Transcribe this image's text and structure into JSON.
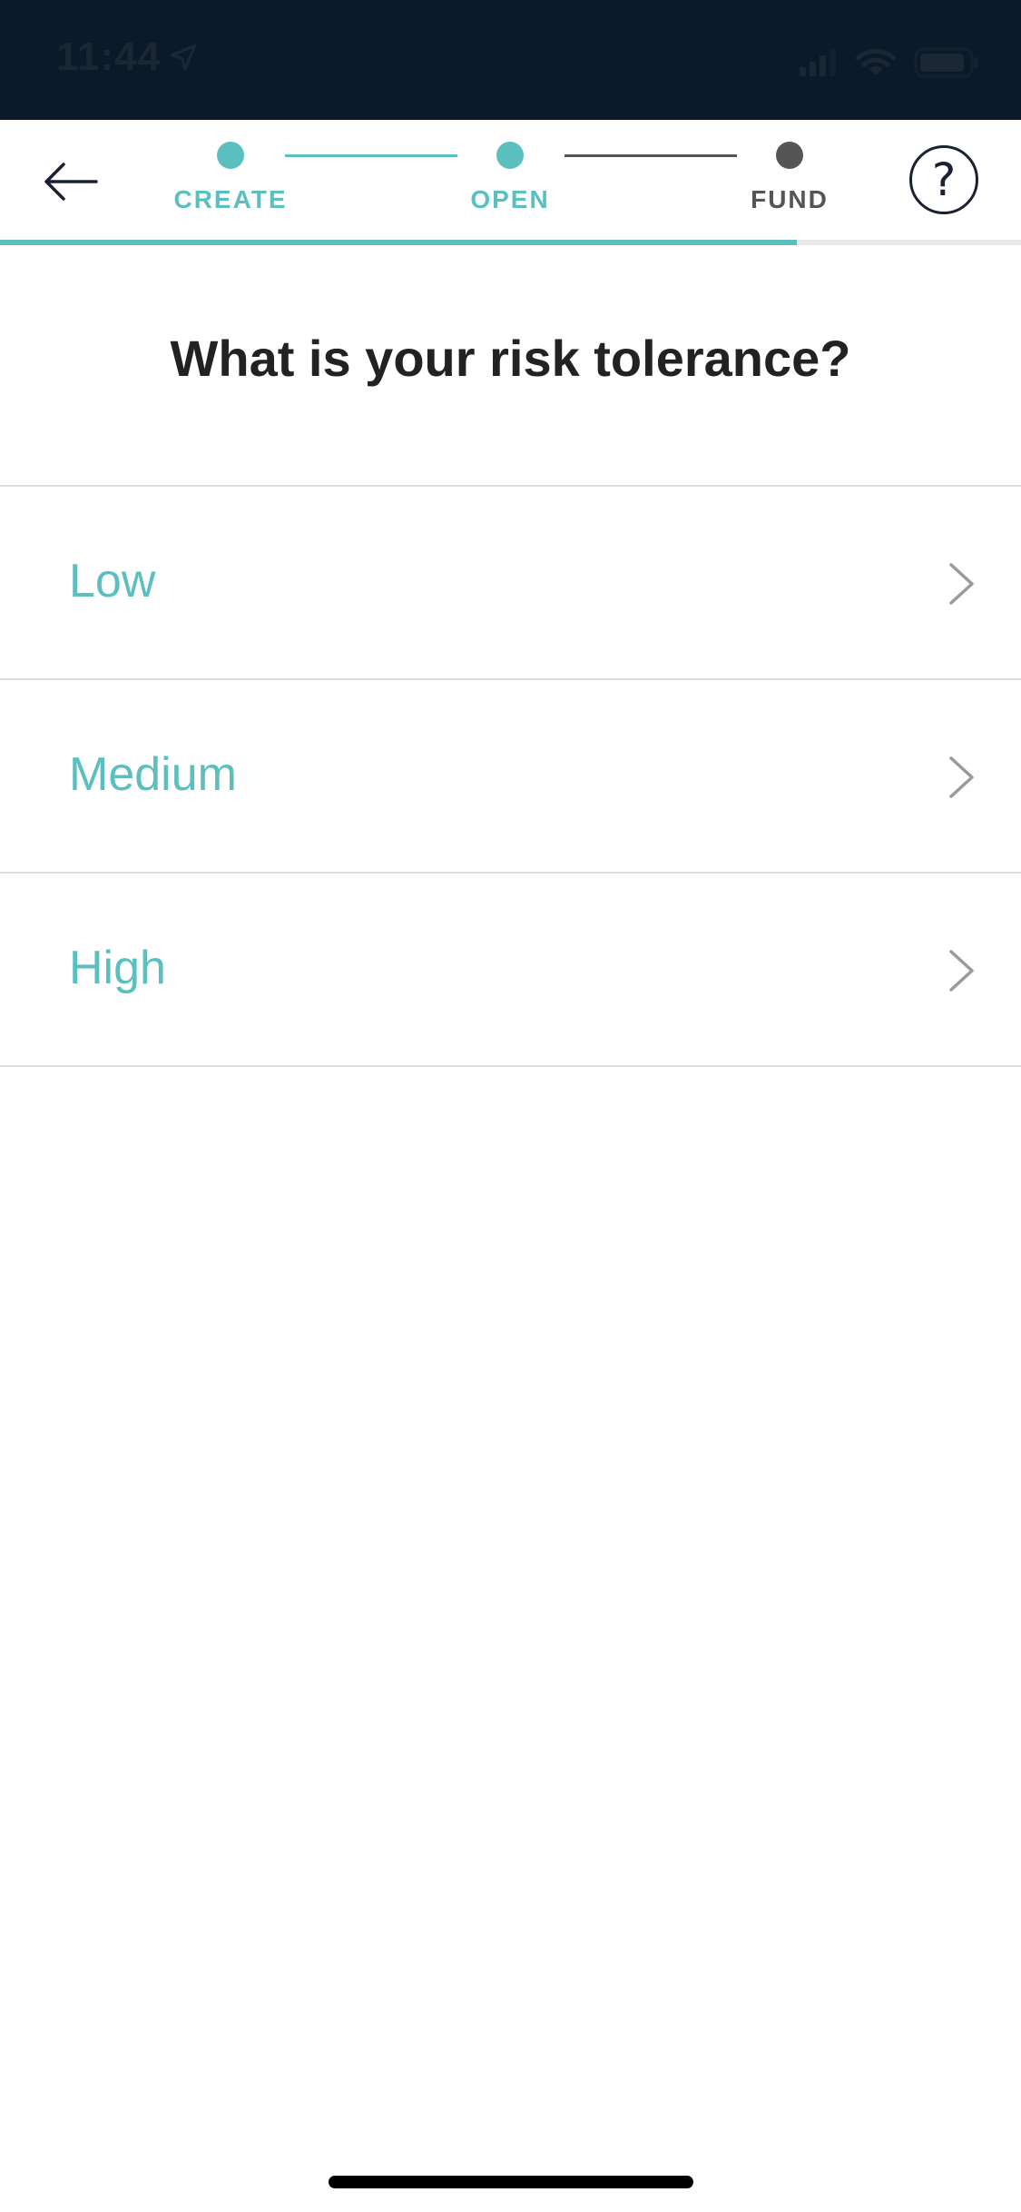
{
  "status_bar": {
    "time": "11:44",
    "icons": [
      "location-arrow-icon",
      "signal-icon",
      "wifi-icon",
      "battery-icon"
    ]
  },
  "header": {
    "back_icon": "arrow-left-icon",
    "help_label": "?",
    "steps": [
      {
        "label": "CREATE",
        "state": "complete",
        "color": "#5bbfbf"
      },
      {
        "label": "OPEN",
        "state": "current",
        "color": "#5bbfbf"
      },
      {
        "label": "FUND",
        "state": "upcoming",
        "color": "#555555"
      }
    ],
    "progress_fraction": 0.78
  },
  "main": {
    "question": "What is your risk tolerance?",
    "options": [
      {
        "label": "Low"
      },
      {
        "label": "Medium"
      },
      {
        "label": "High"
      }
    ]
  },
  "colors": {
    "accent": "#5bbfbf",
    "status_bar_bg": "#0b1a2a",
    "text_dark": "#222222",
    "inactive": "#555555"
  }
}
